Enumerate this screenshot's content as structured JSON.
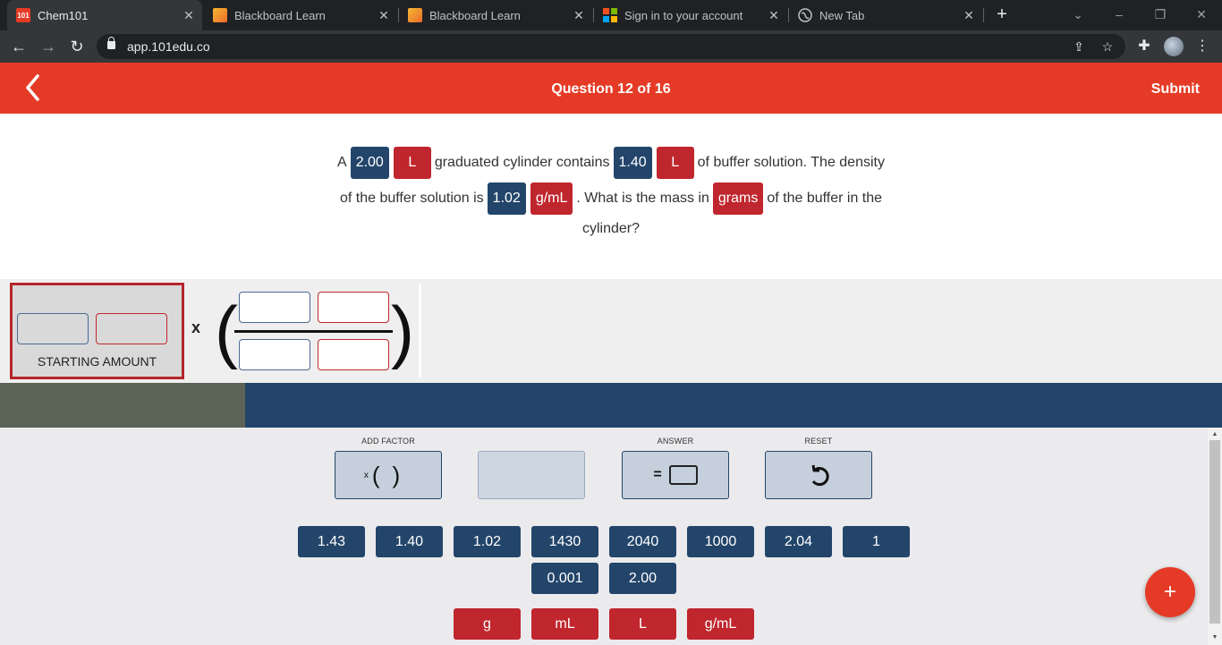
{
  "browser": {
    "tabs": [
      {
        "title": "Chem101",
        "favicon": "101-favicon-icon",
        "active": true
      },
      {
        "title": "Blackboard Learn",
        "favicon": "blackboard-favicon-icon",
        "active": false
      },
      {
        "title": "Blackboard Learn",
        "favicon": "blackboard-favicon-icon",
        "active": false
      },
      {
        "title": "Sign in to your account",
        "favicon": "microsoft-favicon-icon",
        "active": false
      },
      {
        "title": "New Tab",
        "favicon": "globe-favicon-icon",
        "active": false
      }
    ],
    "favicon_text": "101",
    "url": "app.101edu.co"
  },
  "header": {
    "title": "Question 12 of 16",
    "submit_label": "Submit"
  },
  "question": {
    "line1": {
      "t1": "A",
      "v1": "2.00",
      "u1": "L",
      "t2": "graduated cylinder contains",
      "v2": "1.40",
      "u2": "L",
      "t3": "of buffer solution. The density"
    },
    "line2": {
      "t1": "of the buffer solution is",
      "v1": "1.02",
      "u1": "g/mL",
      "t2": ". What is the mass in",
      "u2": "grams",
      "t3": "of the buffer in the"
    },
    "line3": "cylinder?"
  },
  "workarea": {
    "starting_label": "STARTING AMOUNT",
    "times": "x",
    "open_paren": "(",
    "close_paren": ")"
  },
  "controls": {
    "add_factor_label": "ADD FACTOR",
    "add_factor_button": "x( )",
    "answer_label": "ANSWER",
    "answer_button": "=",
    "reset_label": "RESET"
  },
  "number_tiles": [
    "1.43",
    "1.40",
    "1.02",
    "1430",
    "2040",
    "1000",
    "2.04",
    "1",
    "0.001",
    "2.00"
  ],
  "unit_tiles": [
    "g",
    "mL",
    "L",
    "g/mL"
  ],
  "fab_label": "+",
  "colors": {
    "brand_red": "#e53b26",
    "navy": "#23456a",
    "unit_red": "#c0262d"
  }
}
